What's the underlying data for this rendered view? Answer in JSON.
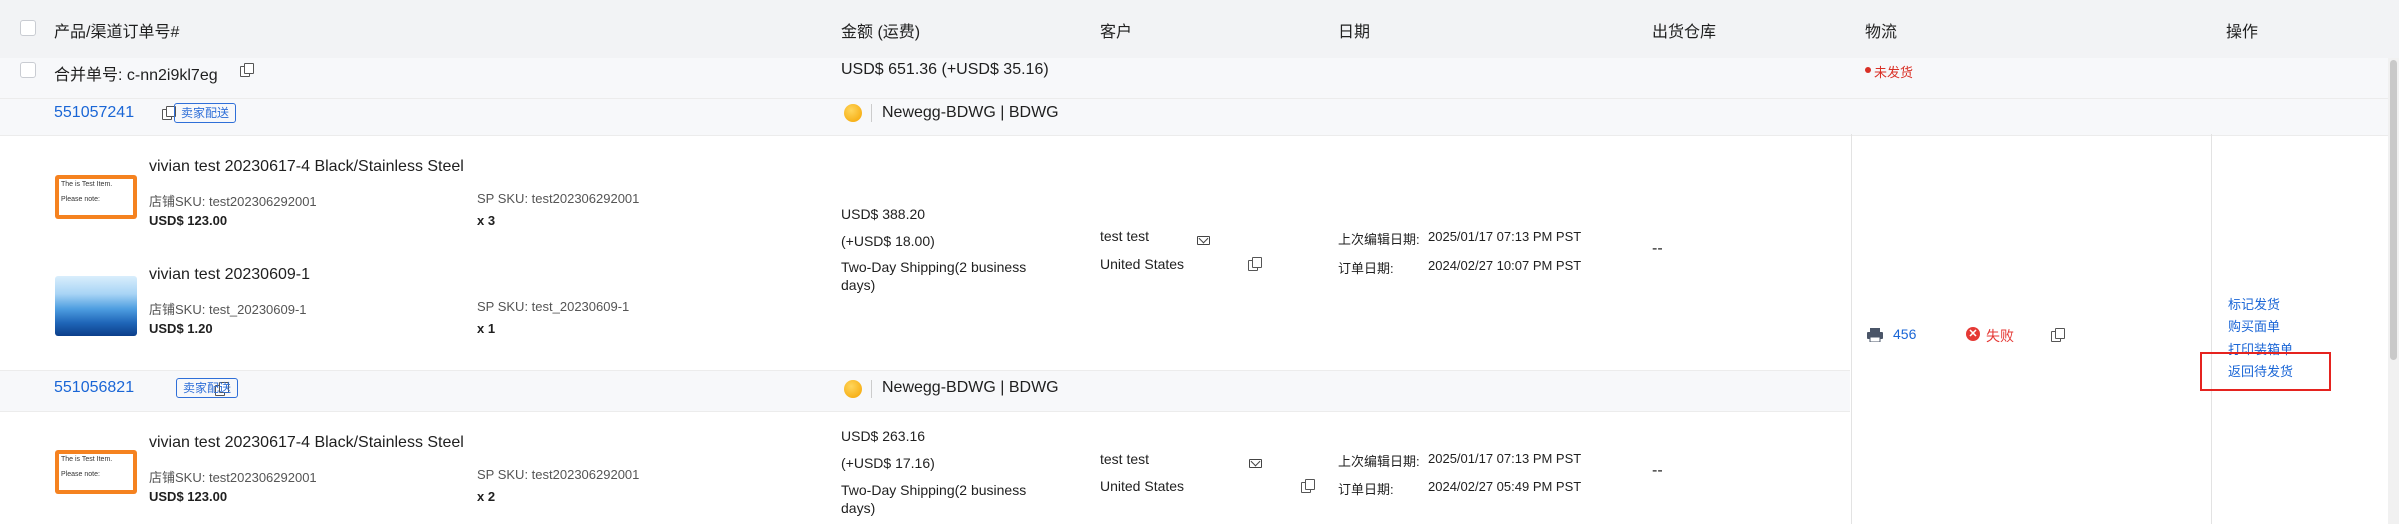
{
  "header": {
    "product": "产品/渠道订单号#",
    "amount": "金额 (运费)",
    "customer": "客户",
    "date": "日期",
    "warehouse": "出货仓库",
    "logistics": "物流",
    "actions": "操作"
  },
  "merge": {
    "label": "合并单号: c-nn2i9kl7eg",
    "total": "USD$ 651.36 (+USD$ 35.16)",
    "status": "未发货",
    "status_color": "#d93026"
  },
  "orders": [
    {
      "order_no": "551057241",
      "tag": "卖家配送",
      "store": "Newegg-BDWG | BDWG",
      "items": [
        {
          "title": "vivian test 20230617-4 Black/Stainless Steel",
          "sku": "店铺SKU: test202306292001",
          "sp_sku": "SP SKU: test202306292001",
          "price": "USD$ 123.00",
          "qty": "x 3",
          "img_text1": "The is Test Item.",
          "img_text2": "Please note:"
        },
        {
          "title": "vivian test 20230609-1",
          "sku": "店铺SKU: test_20230609-1",
          "sp_sku": "SP SKU: test_20230609-1",
          "price": "USD$ 1.20",
          "qty": "x 1"
        }
      ],
      "amount": "USD$ 388.20",
      "shipping_fee": "(+USD$ 18.00)",
      "shipping_line1": "Two-Day Shipping(2 business",
      "shipping_line2": "days)",
      "customer_name": "test test",
      "country": "United States",
      "edit_date_label": "上次编辑日期:",
      "edit_date": "2025/01/17 07:13 PM PST",
      "order_date_label": "订单日期:",
      "order_date": "2024/02/27 10:07 PM PST",
      "warehouse": "--"
    },
    {
      "order_no": "551056821",
      "tag": "卖家配送",
      "store": "Newegg-BDWG | BDWG",
      "items": [
        {
          "title": "vivian test 20230617-4 Black/Stainless Steel",
          "sku": "店铺SKU: test202306292001",
          "sp_sku": "SP SKU: test202306292001",
          "price": "USD$ 123.00",
          "qty": "x 2",
          "img_text1": "The is Test Item.",
          "img_text2": "Please note:"
        }
      ],
      "amount": "USD$ 263.16",
      "shipping_fee": "(+USD$ 17.16)",
      "shipping_line1": "Two-Day Shipping(2 business",
      "shipping_line2": "days)",
      "customer_name": "test test",
      "country": "United States",
      "edit_date_label": "上次编辑日期:",
      "edit_date": "2025/01/17 07:13 PM PST",
      "order_date_label": "订单日期:",
      "order_date": "2024/02/27 05:49 PM PST",
      "warehouse": "--"
    }
  ],
  "logistics": {
    "tracking": "456",
    "status": "失败"
  },
  "actions": {
    "mark_shipped": "标记发货",
    "buy_label": "购买面单",
    "print_packing": "打印装箱单",
    "return_pending": "返回待发货"
  },
  "colors": {
    "link": "#1a66d6",
    "fail": "#e53935",
    "highlight_box": "#e5231f"
  }
}
